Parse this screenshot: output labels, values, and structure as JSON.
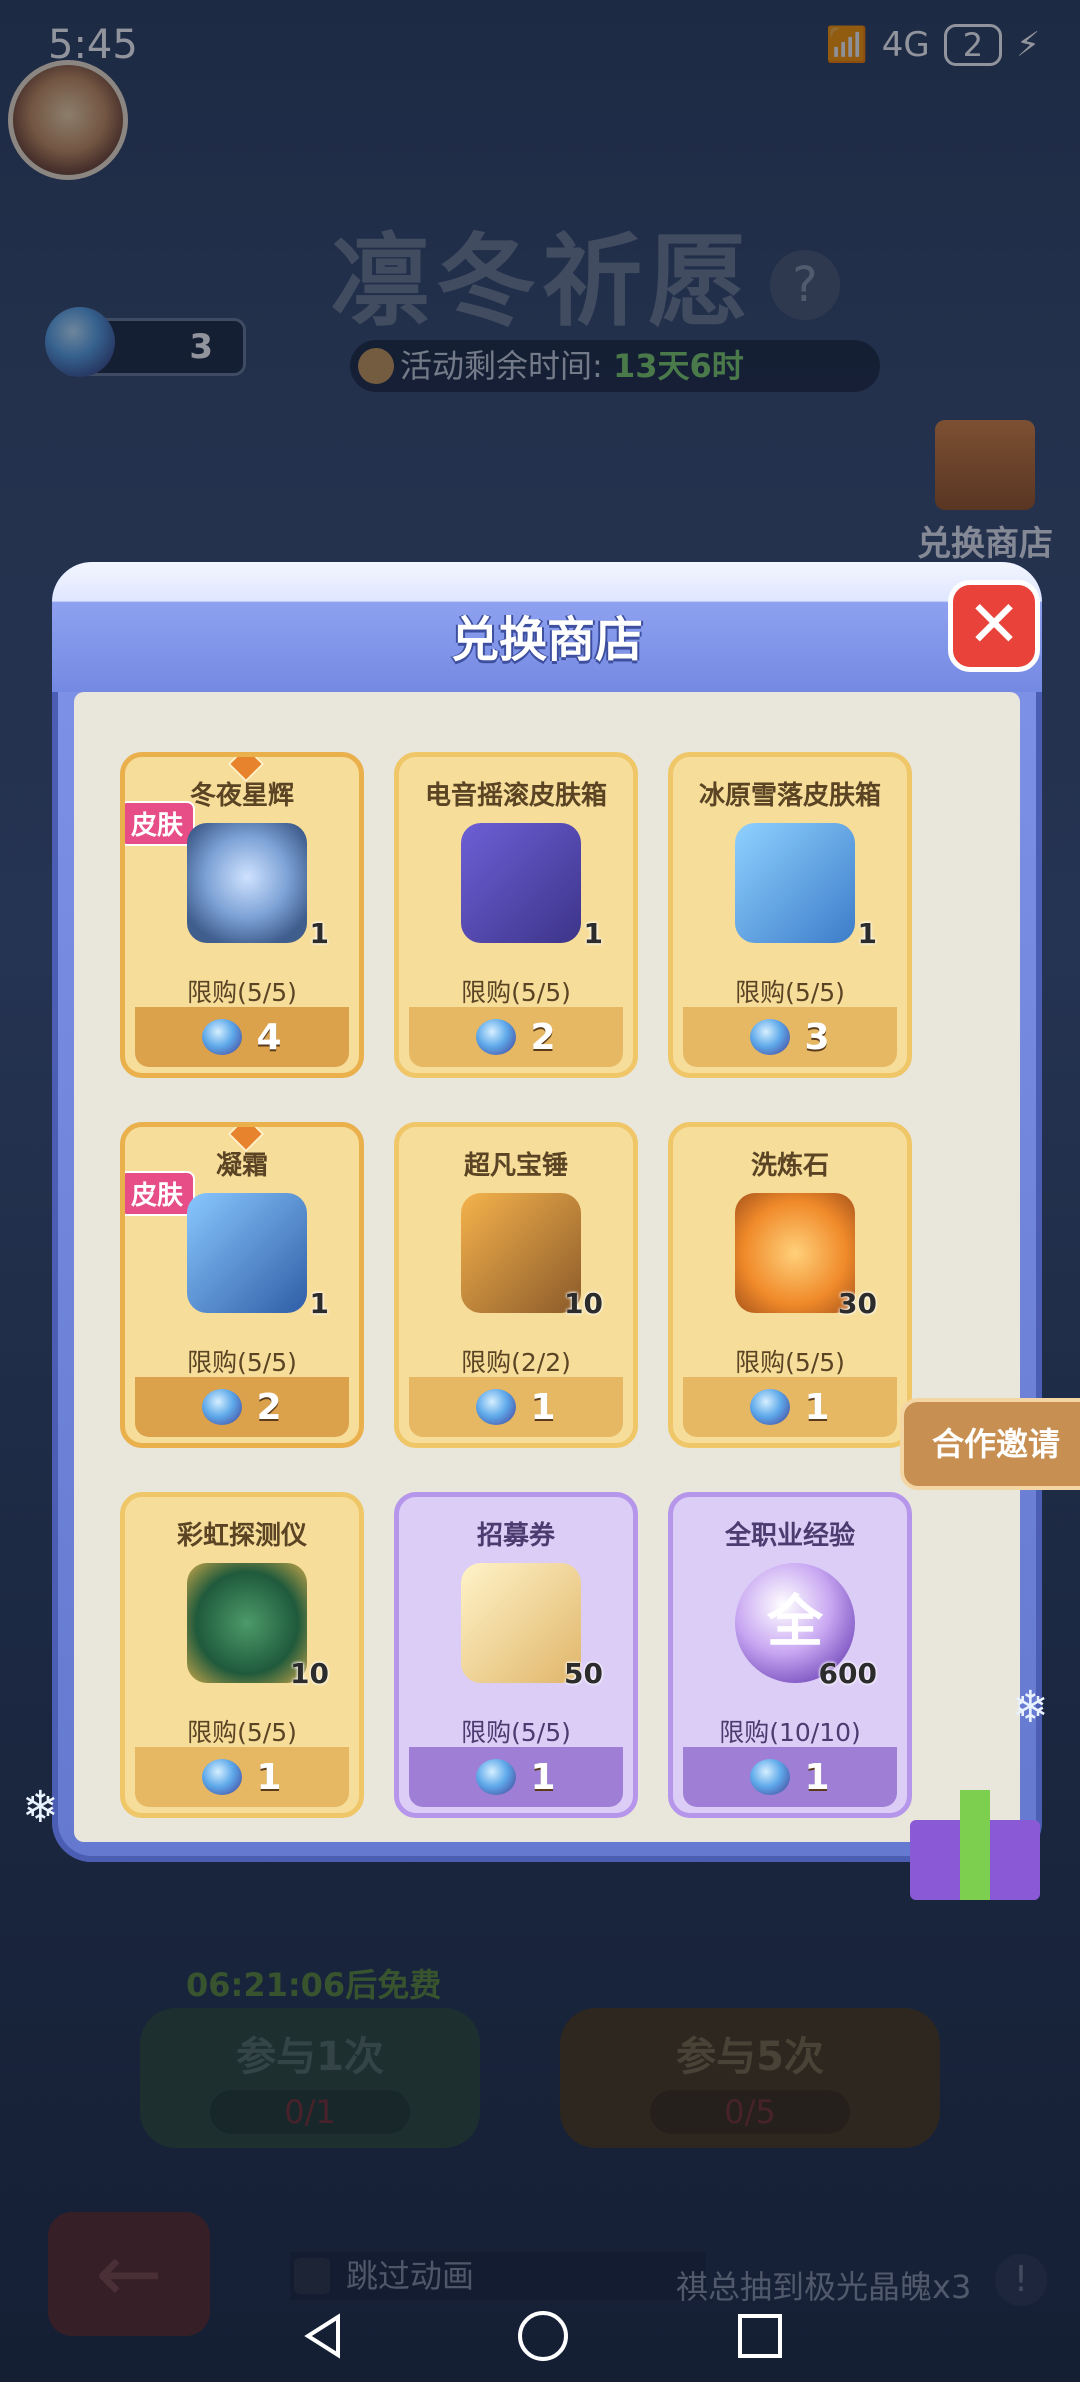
{
  "status_bar": {
    "time": "5:45",
    "network": "4G",
    "battery": "2"
  },
  "event": {
    "title": "凛冬祈愿",
    "currency_value": "3",
    "timer_label": "活动剩余时间:",
    "timer_value": "13天6时",
    "shop_label": "兑换商店"
  },
  "bottom": {
    "free_text": "06:21:06后免费",
    "btn1_label": "参与1次",
    "btn1_count": "0/1",
    "btn5_label": "参与5次",
    "btn5_count": "0/5",
    "skip_label": "跳过动画",
    "notice_text": "祺总抽到极光晶魄x3"
  },
  "modal": {
    "title": "兑换商店",
    "items": [
      {
        "name": "冬夜星辉",
        "tag": "皮肤",
        "qty": "1",
        "limit": "限购(5/5)",
        "price": "4",
        "icon": "ice-hero-skin-icon"
      },
      {
        "name": "电音摇滚皮肤箱",
        "qty": "1",
        "limit": "限购(5/5)",
        "price": "2",
        "icon": "rock-skin-box-icon"
      },
      {
        "name": "冰原雪落皮肤箱",
        "qty": "1",
        "limit": "限购(5/5)",
        "price": "3",
        "icon": "ice-skin-box-icon"
      },
      {
        "name": "凝霜",
        "tag": "皮肤",
        "qty": "1",
        "limit": "限购(5/5)",
        "price": "2",
        "icon": "frost-dagger-icon"
      },
      {
        "name": "超凡宝锤",
        "qty": "10",
        "limit": "限购(2/2)",
        "price": "1",
        "icon": "hammer-icon"
      },
      {
        "name": "洗炼石",
        "qty": "30",
        "limit": "限购(5/5)",
        "price": "1",
        "icon": "refine-stone-icon"
      },
      {
        "name": "彩虹探测仪",
        "qty": "10",
        "limit": "限购(5/5)",
        "price": "1",
        "icon": "rainbow-probe-icon"
      },
      {
        "name": "招募券",
        "qty": "50",
        "limit": "限购(5/5)",
        "price": "1",
        "icon": "recruit-ticket-icon"
      },
      {
        "name": "全职业经验",
        "qty": "600",
        "limit": "限购(10/10)",
        "price": "1",
        "icon": "all-class-exp-icon",
        "glyph": "全"
      }
    ]
  },
  "side_invite": "合作邀请"
}
